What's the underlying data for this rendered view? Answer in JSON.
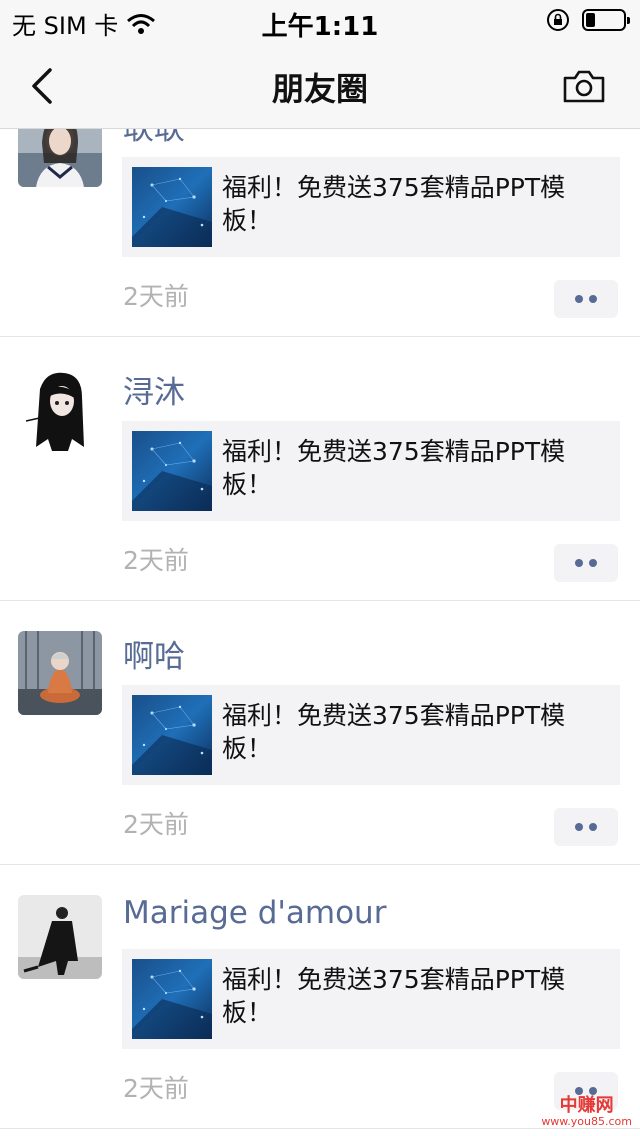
{
  "status_bar": {
    "carrier": "无 SIM 卡",
    "time": "上午1:11",
    "battery_level": 0.25
  },
  "nav": {
    "title": "朋友圈",
    "back_icon": "chevron-left-icon",
    "camera_icon": "camera-icon"
  },
  "posts": [
    {
      "username": "耿耿",
      "card_text": "福利！免费送375套精品PPT模板！",
      "time": "2天前"
    },
    {
      "username": "浔沐",
      "card_text": "福利！免费送375套精品PPT模板！",
      "time": "2天前"
    },
    {
      "username": "啊哈",
      "card_text": "福利！免费送375套精品PPT模板！",
      "time": "2天前"
    },
    {
      "username": "Mariage d'amour",
      "card_text": "福利！免费送375套精品PPT模板！",
      "time": "2天前"
    }
  ],
  "watermark": {
    "title": "中赚网",
    "url": "www.you85.com"
  },
  "colors": {
    "link_blue": "#576b95",
    "bar_bg": "#f7f7f7",
    "card_bg": "#f3f3f5",
    "time_gray": "#b2b2b2",
    "watermark_red": "#e53935"
  }
}
